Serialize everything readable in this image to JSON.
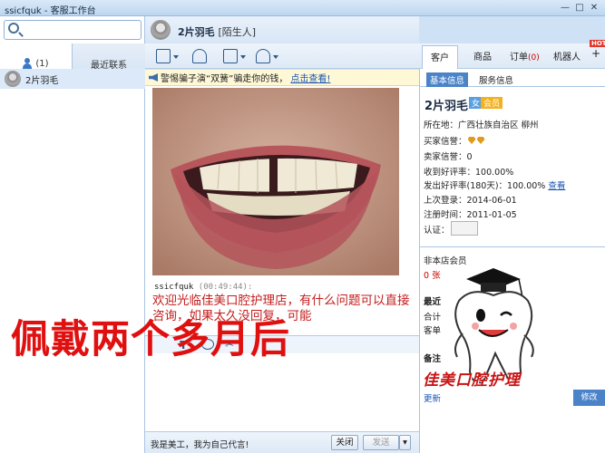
{
  "window": {
    "title": "ssicfquk - 客服工作台",
    "controls": [
      "—",
      "□",
      "✕"
    ]
  },
  "left": {
    "tabs": [
      {
        "label": "(1)"
      },
      {
        "label": "最近联系"
      }
    ],
    "contacts": [
      {
        "name": "2片羽毛"
      }
    ]
  },
  "chat": {
    "header": {
      "name": "2片羽毛",
      "tag": "[陌生人]"
    },
    "notice": {
      "text": "警惕骗子演“双簧”骗走你的钱，",
      "link": "点击查看!"
    },
    "message": {
      "sender": "ssicfquk",
      "time": "(00:49:44):",
      "text": "欢迎光临佳美口腔护理店，有什么问题可以直接咨询，如果太久没回复，可能"
    },
    "signature": "我是美工，我为自己代言!",
    "close_label": "关闭",
    "send_label": "发送"
  },
  "right": {
    "tabs": [
      {
        "label": "客户"
      },
      {
        "label": "商品"
      },
      {
        "label": "订单",
        "count": "(0)"
      },
      {
        "label": "机器人"
      }
    ],
    "hot": "HOT",
    "subtabs": [
      {
        "label": "基本信息"
      },
      {
        "label": "服务信息"
      }
    ],
    "customer": {
      "name": "2片羽毛",
      "gender": "女",
      "vip": "会员",
      "location": "所在地：广西壮族自治区 柳州",
      "buyer_credit": "买家信誉：",
      "seller_credit": "卖家信誉：0",
      "good_rate": "收到好评率：100.00%",
      "given_rate": "发出好评率(180天)：100.00%",
      "view_link": "查看",
      "last_login": "上次登录：2014-06-01",
      "register_time": "注册时间：2011-01-05",
      "cert": "认证："
    },
    "lower": {
      "line1": "非本店会员",
      "line2": "0 张",
      "line3": "最近",
      "line4": "合计",
      "line5": "客单",
      "line6": "备注",
      "line7": "更新"
    },
    "button": "修改"
  },
  "overlay": {
    "watermark": "佩戴两个多月后",
    "mascot_caption": "佳美口腔护理"
  },
  "icons": [
    "search-icon",
    "person-icon",
    "minimize-icon",
    "maximize-icon",
    "close-icon",
    "transfer-icon",
    "add-contact-icon",
    "screenshot-icon",
    "alert-icon",
    "speaker-icon",
    "gem-icon",
    "cert-icon",
    "tooth-mascot-icon"
  ],
  "colors": {
    "accent": "#4b83c8",
    "alert_red": "#c41c1c",
    "watermark_red": "#e01010",
    "link_blue": "#1a56b4"
  }
}
